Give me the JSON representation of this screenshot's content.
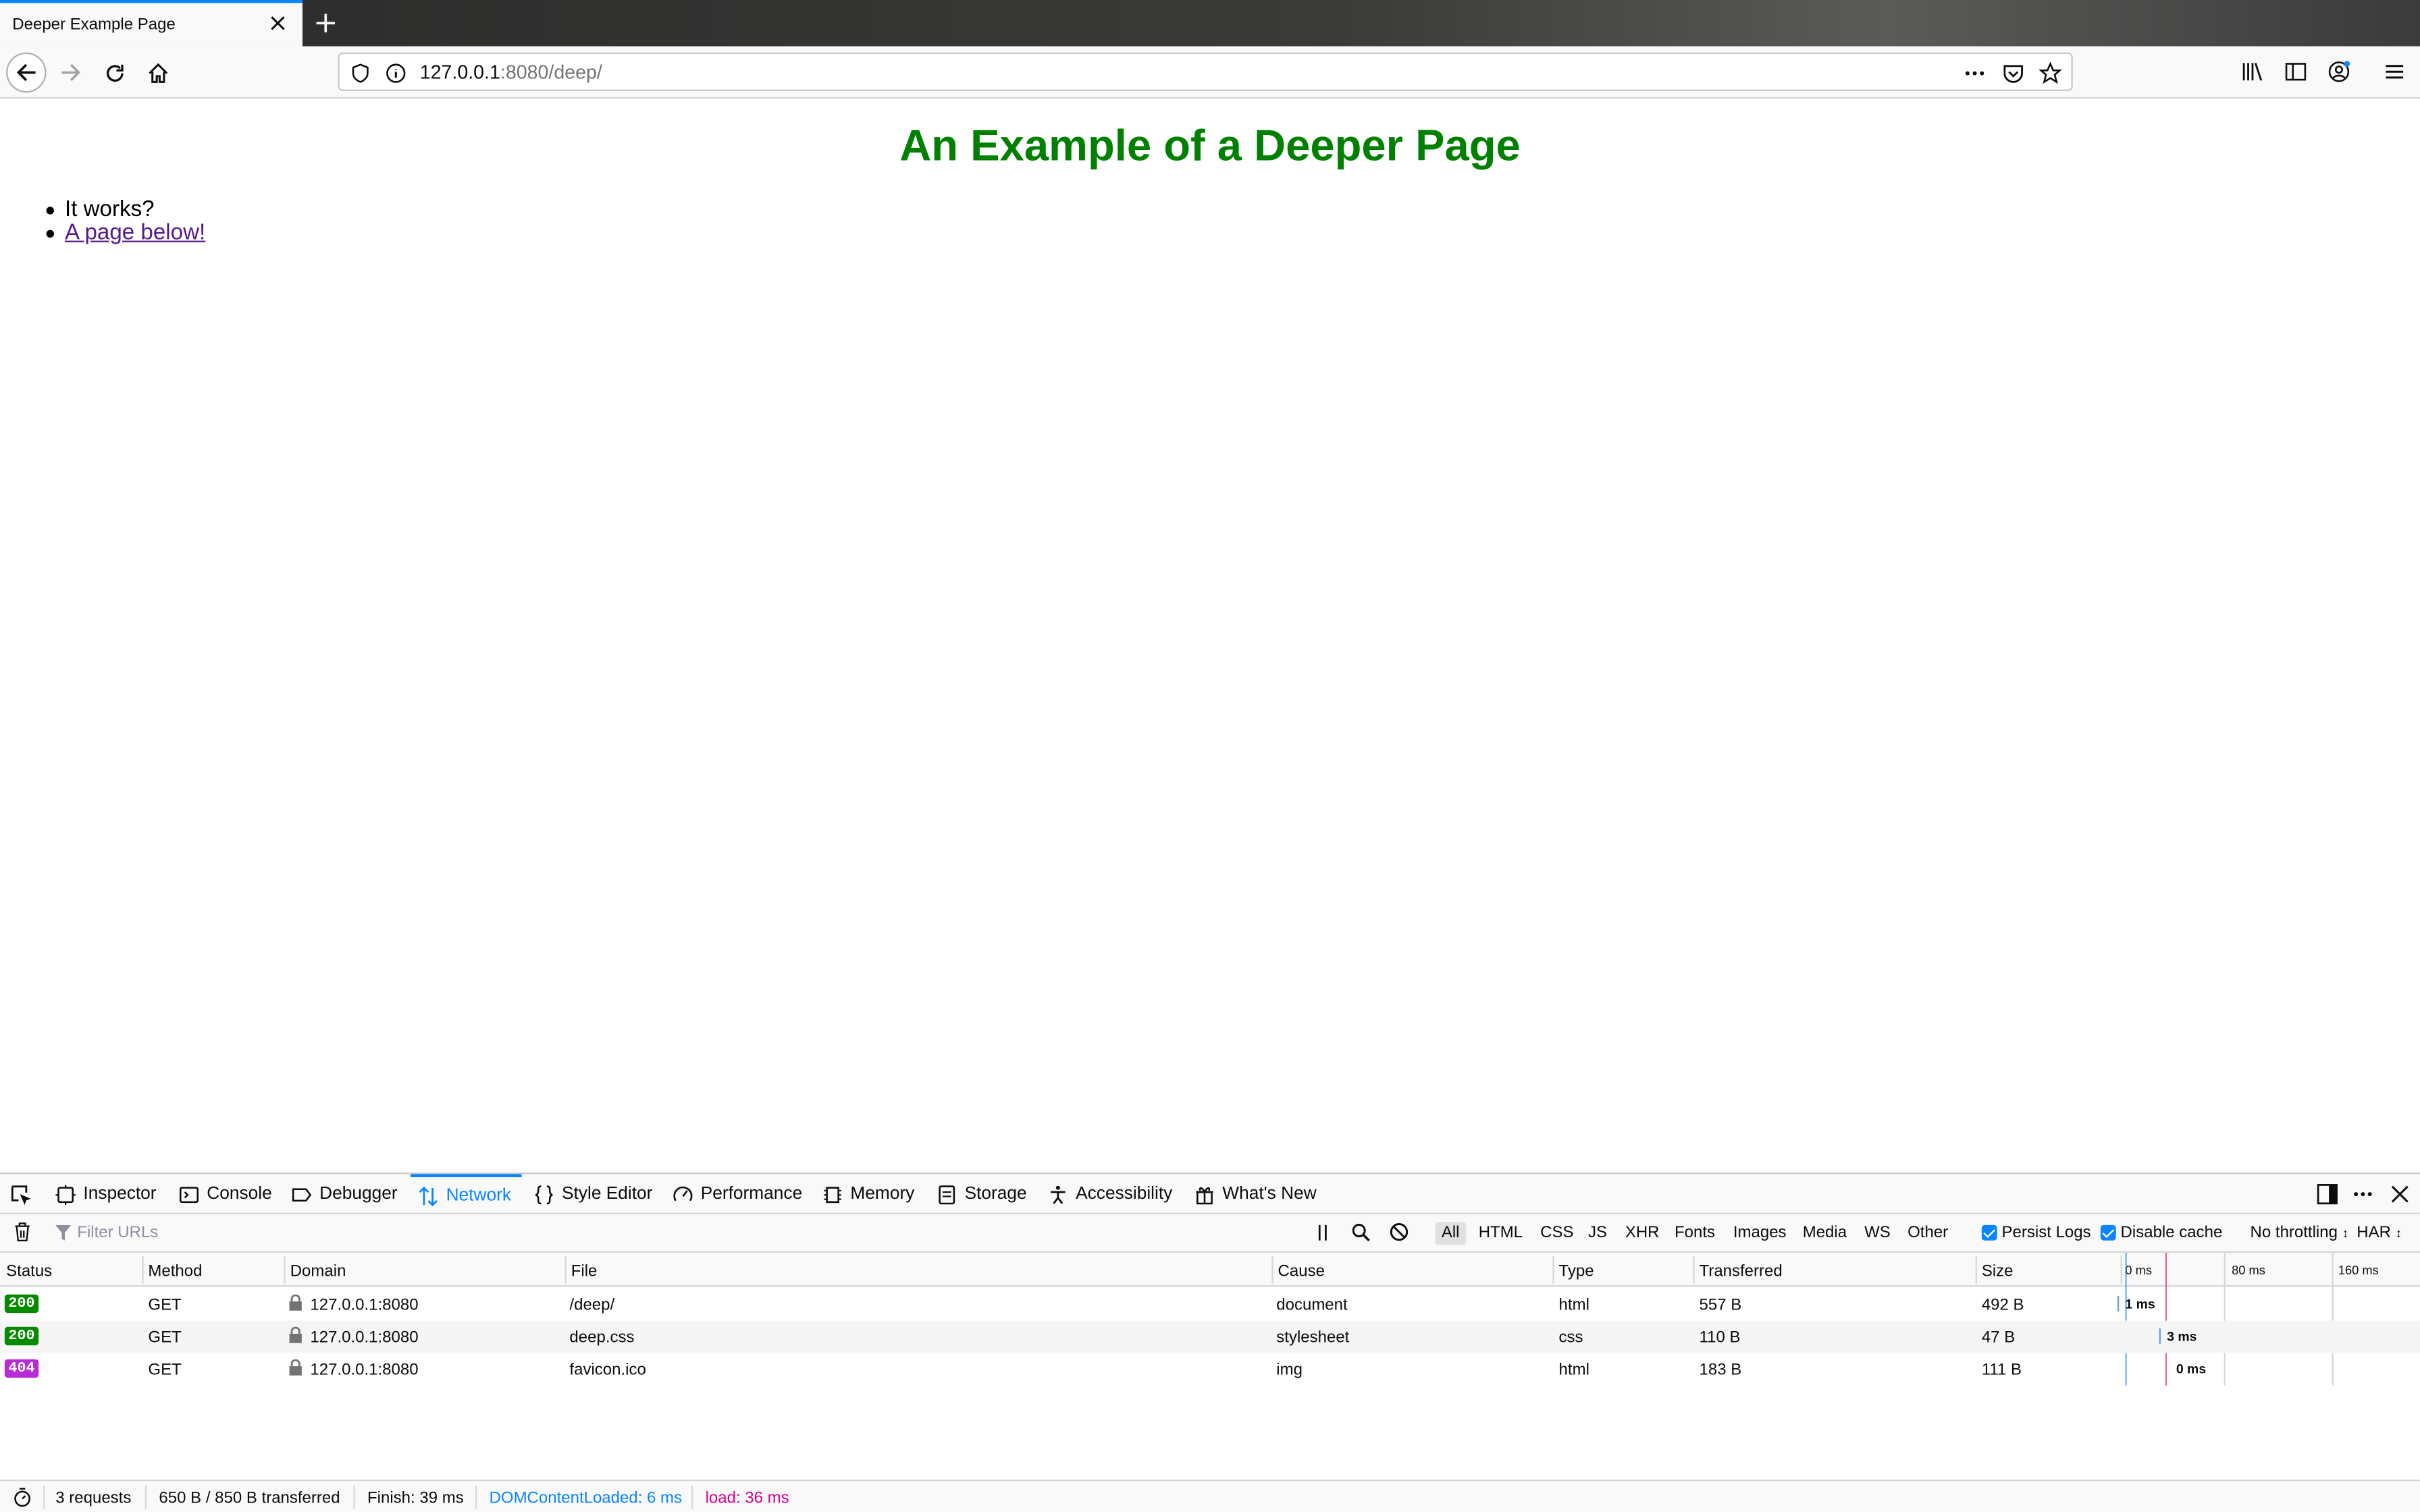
{
  "browser": {
    "tab_title": "Deeper Example Page",
    "url_host": "127.0.0.1",
    "url_rest": ":8080/deep/"
  },
  "page": {
    "heading": "An Example of a Deeper Page",
    "items": [
      "It works?",
      "A page below!"
    ],
    "heading_color": "#008000",
    "link_color": "#551a8b"
  },
  "devtools": {
    "tabs": [
      "Inspector",
      "Console",
      "Debugger",
      "Network",
      "Style Editor",
      "Performance",
      "Memory",
      "Storage",
      "Accessibility",
      "What's New"
    ],
    "selected_tab": "Network",
    "filter_placeholder": "Filter URLs",
    "filter_types": [
      "All",
      "HTML",
      "CSS",
      "JS",
      "XHR",
      "Fonts",
      "Images",
      "Media",
      "WS",
      "Other"
    ],
    "persist_logs": "Persist Logs",
    "disable_cache": "Disable cache",
    "throttling": "No throttling",
    "har": "HAR",
    "columns": [
      "Status",
      "Method",
      "Domain",
      "File",
      "Cause",
      "Type",
      "Transferred",
      "Size"
    ],
    "timeline_ticks": [
      "0 ms",
      "80 ms",
      "160 ms"
    ],
    "requests": [
      {
        "status": "200",
        "status_color": "#058b00",
        "method": "GET",
        "domain": "127.0.0.1:8080",
        "file": "/deep/",
        "cause": "document",
        "type": "html",
        "transferred": "557 B",
        "size": "492 B",
        "timing": "1 ms"
      },
      {
        "status": "200",
        "status_color": "#058b00",
        "method": "GET",
        "domain": "127.0.0.1:8080",
        "file": "deep.css",
        "cause": "stylesheet",
        "type": "css",
        "transferred": "110 B",
        "size": "47 B",
        "timing": "3 ms"
      },
      {
        "status": "404",
        "status_color": "#b82cd6",
        "method": "GET",
        "domain": "127.0.0.1:8080",
        "file": "favicon.ico",
        "cause": "img",
        "type": "html",
        "transferred": "183 B",
        "size": "111 B",
        "timing": "0 ms"
      }
    ],
    "summary": {
      "requests": "3 requests",
      "transferred": "650 B / 850 B transferred",
      "finish": "Finish: 39 ms",
      "dom_loaded": "DOMContentLoaded: 6 ms",
      "load": "load: 36 ms"
    }
  }
}
